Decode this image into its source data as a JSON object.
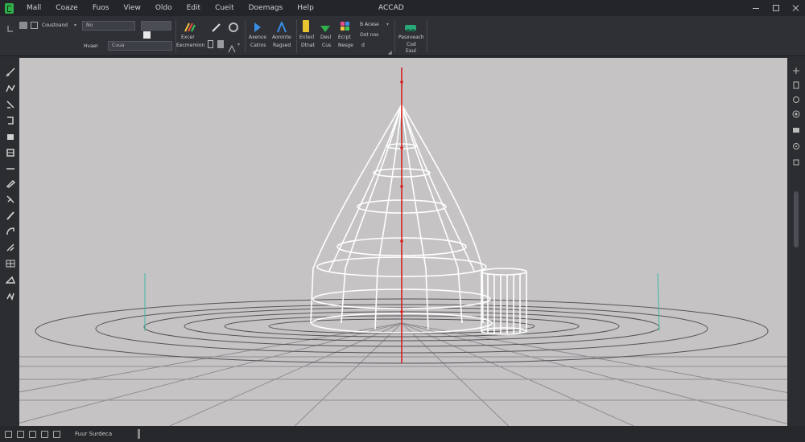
{
  "app": {
    "title": "ACCAD",
    "logo": "app-logo-icon"
  },
  "menu": [
    "Mall",
    "Coaze",
    "Fuos",
    "View",
    "Oldo",
    "Edit",
    "Cueit",
    "Doemags",
    "Help"
  ],
  "ribbon": {
    "command_label": "Coustoand",
    "layer_field": "No",
    "props_label": "Hvaer",
    "props_value": "Cuua",
    "groups": {
      "g1_label": "Excer",
      "g1_sub": "Eecmemion",
      "g2_label1": "Axence",
      "g2_sub1": "Catros",
      "g2_label2": "Aoronte",
      "g2_sub2": "Ragsed",
      "g3_label1": "Entecl",
      "g3_sub1": "Dtnat",
      "g3_label2": "Desl",
      "g3_sub2": "Cus",
      "g3_label3": "Ecrpt",
      "g3_sub3": "Nesge",
      "g3_label4": "B Acese",
      "g3_sub4": "Oot nos",
      "g3_sub5": "d",
      "g4_label": "Pasxveach",
      "g4_sub": "Cod",
      "g4_sub2": "Eaul"
    }
  },
  "left_tools": [
    "line-icon",
    "polyline-icon",
    "move-icon",
    "rotate-icon",
    "rectangle-icon",
    "hatch-icon",
    "dimension-icon",
    "pen-icon",
    "trim-icon",
    "pencil-icon",
    "arc-icon",
    "scale-icon",
    "array-icon",
    "stretch-icon",
    "explode-icon"
  ],
  "right_tools": [
    "view-icon",
    "orbit-icon",
    "pan-icon",
    "zoom-icon",
    "layers-icon",
    "snap-icon",
    "grid-icon"
  ],
  "status": {
    "text": "Fuur Surdeca"
  },
  "colors": {
    "background": "#2b2d31",
    "viewport": "#c6c3c5",
    "axis": "#d42020",
    "wire": "#ffffff",
    "ucs": "#3fb8a0"
  }
}
